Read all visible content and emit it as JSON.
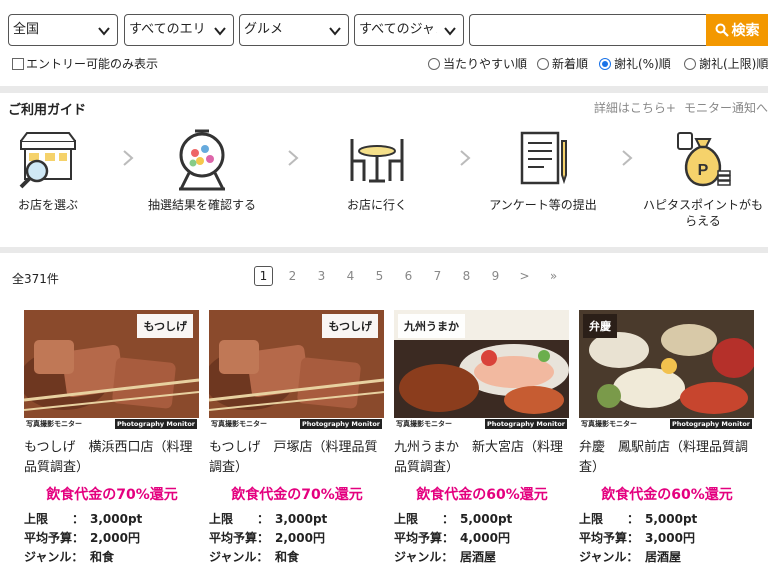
{
  "filters": {
    "region": "全国",
    "area": "すべてのエリア",
    "category": "グルメ",
    "genre": "すべてのジャンル",
    "keyword_value": "",
    "search_label": "検索",
    "entry_only_label": "エントリー可能のみ表示"
  },
  "sort": {
    "options": [
      "当たりやすい順",
      "新着順",
      "謝礼(%)順",
      "謝礼(上限)順"
    ],
    "selected_index": 2
  },
  "guide": {
    "title": "ご利用ガイド",
    "details_link": "詳細はこちら+",
    "notify_link": "モニター通知へ",
    "steps": [
      {
        "label": "お店を選ぶ",
        "icon": "shop-search-icon"
      },
      {
        "label": "抽選結果を確認する",
        "icon": "lottery-drum-icon"
      },
      {
        "label": "お店に行く",
        "icon": "dining-table-icon"
      },
      {
        "label": "アンケート等の提出",
        "icon": "survey-document-icon"
      },
      {
        "label": "ハピタスポイントがもらえる",
        "icon": "point-bag-icon"
      }
    ]
  },
  "results": {
    "total": "全371件",
    "pages": [
      "1",
      "2",
      "3",
      "4",
      "5",
      "6",
      "7",
      "8",
      "9",
      ">",
      "»"
    ],
    "current_page": "1"
  },
  "monitor_band": {
    "left": "写真撮影モニター",
    "right": "Photography Monitor"
  },
  "spec_labels": {
    "limit": "上限　　：",
    "budget": "平均予算：",
    "genre": "ジャンル："
  },
  "cards": [
    {
      "name": "もつしげ　横浜西口店（料理品質調査）",
      "logo": "もつしげ",
      "reward": "飲食代金の70%還元",
      "limit": "3,000pt",
      "budget": "2,000円",
      "genre": "和食"
    },
    {
      "name": "もつしげ　戸塚店（料理品質調査）",
      "logo": "もつしげ",
      "reward": "飲食代金の70%還元",
      "limit": "3,000pt",
      "budget": "2,000円",
      "genre": "和食"
    },
    {
      "name": "九州うまか　新大宮店（料理品質調査）",
      "logo": "九州うまか",
      "reward": "飲食代金の60%還元",
      "limit": "5,000pt",
      "budget": "4,000円",
      "genre": "居酒屋"
    },
    {
      "name": "弁慶　鳳駅前店（料理品質調査）",
      "logo": "弁慶",
      "reward": "飲食代金の60%還元",
      "limit": "5,000pt",
      "budget": "3,000円",
      "genre": "居酒屋"
    }
  ],
  "colors": {
    "accent": "#f39800",
    "reward": "#e4007f",
    "radio": "#1a73e8"
  }
}
